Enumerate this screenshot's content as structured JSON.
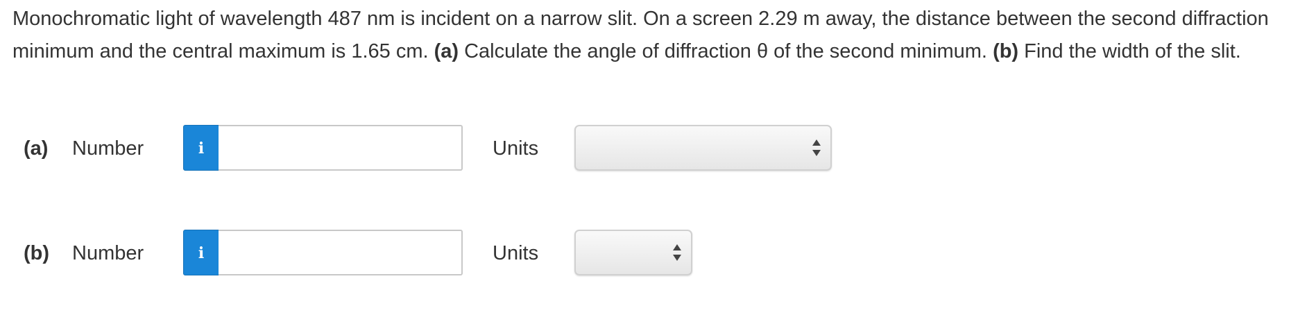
{
  "question": {
    "text_intro": "Monochromatic light of wavelength 487 nm is incident on a narrow slit. On a screen 2.29 m away, the distance between the second diffraction minimum and the central maximum is 1.65 cm. ",
    "part_a_tag": "(a)",
    "part_a_text": " Calculate the angle of diffraction θ of the second minimum. ",
    "part_b_tag": "(b)",
    "part_b_text": " Find the width of the slit."
  },
  "parts": [
    {
      "label": "(a)",
      "number_label": "Number",
      "info_icon": "i",
      "number_value": "",
      "units_label": "Units",
      "units_selected": ""
    },
    {
      "label": "(b)",
      "number_label": "Number",
      "info_icon": "i",
      "number_value": "",
      "units_label": "Units",
      "units_selected": ""
    }
  ],
  "colors": {
    "info_button": "#1a86d8",
    "text": "#333333",
    "input_border": "#c8c8c8"
  }
}
